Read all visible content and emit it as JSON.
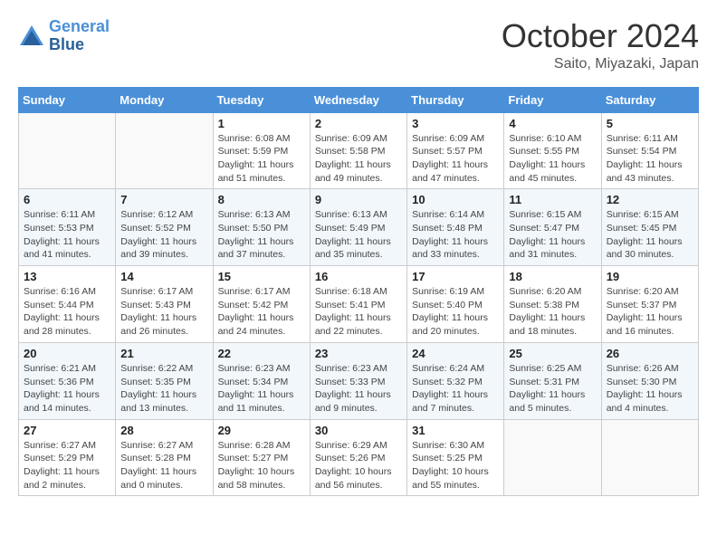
{
  "header": {
    "logo_line1": "General",
    "logo_line2": "Blue",
    "month": "October 2024",
    "location": "Saito, Miyazaki, Japan"
  },
  "weekdays": [
    "Sunday",
    "Monday",
    "Tuesday",
    "Wednesday",
    "Thursday",
    "Friday",
    "Saturday"
  ],
  "weeks": [
    [
      {
        "day": "",
        "info": ""
      },
      {
        "day": "",
        "info": ""
      },
      {
        "day": "1",
        "info": "Sunrise: 6:08 AM\nSunset: 5:59 PM\nDaylight: 11 hours and 51 minutes."
      },
      {
        "day": "2",
        "info": "Sunrise: 6:09 AM\nSunset: 5:58 PM\nDaylight: 11 hours and 49 minutes."
      },
      {
        "day": "3",
        "info": "Sunrise: 6:09 AM\nSunset: 5:57 PM\nDaylight: 11 hours and 47 minutes."
      },
      {
        "day": "4",
        "info": "Sunrise: 6:10 AM\nSunset: 5:55 PM\nDaylight: 11 hours and 45 minutes."
      },
      {
        "day": "5",
        "info": "Sunrise: 6:11 AM\nSunset: 5:54 PM\nDaylight: 11 hours and 43 minutes."
      }
    ],
    [
      {
        "day": "6",
        "info": "Sunrise: 6:11 AM\nSunset: 5:53 PM\nDaylight: 11 hours and 41 minutes."
      },
      {
        "day": "7",
        "info": "Sunrise: 6:12 AM\nSunset: 5:52 PM\nDaylight: 11 hours and 39 minutes."
      },
      {
        "day": "8",
        "info": "Sunrise: 6:13 AM\nSunset: 5:50 PM\nDaylight: 11 hours and 37 minutes."
      },
      {
        "day": "9",
        "info": "Sunrise: 6:13 AM\nSunset: 5:49 PM\nDaylight: 11 hours and 35 minutes."
      },
      {
        "day": "10",
        "info": "Sunrise: 6:14 AM\nSunset: 5:48 PM\nDaylight: 11 hours and 33 minutes."
      },
      {
        "day": "11",
        "info": "Sunrise: 6:15 AM\nSunset: 5:47 PM\nDaylight: 11 hours and 31 minutes."
      },
      {
        "day": "12",
        "info": "Sunrise: 6:15 AM\nSunset: 5:45 PM\nDaylight: 11 hours and 30 minutes."
      }
    ],
    [
      {
        "day": "13",
        "info": "Sunrise: 6:16 AM\nSunset: 5:44 PM\nDaylight: 11 hours and 28 minutes."
      },
      {
        "day": "14",
        "info": "Sunrise: 6:17 AM\nSunset: 5:43 PM\nDaylight: 11 hours and 26 minutes."
      },
      {
        "day": "15",
        "info": "Sunrise: 6:17 AM\nSunset: 5:42 PM\nDaylight: 11 hours and 24 minutes."
      },
      {
        "day": "16",
        "info": "Sunrise: 6:18 AM\nSunset: 5:41 PM\nDaylight: 11 hours and 22 minutes."
      },
      {
        "day": "17",
        "info": "Sunrise: 6:19 AM\nSunset: 5:40 PM\nDaylight: 11 hours and 20 minutes."
      },
      {
        "day": "18",
        "info": "Sunrise: 6:20 AM\nSunset: 5:38 PM\nDaylight: 11 hours and 18 minutes."
      },
      {
        "day": "19",
        "info": "Sunrise: 6:20 AM\nSunset: 5:37 PM\nDaylight: 11 hours and 16 minutes."
      }
    ],
    [
      {
        "day": "20",
        "info": "Sunrise: 6:21 AM\nSunset: 5:36 PM\nDaylight: 11 hours and 14 minutes."
      },
      {
        "day": "21",
        "info": "Sunrise: 6:22 AM\nSunset: 5:35 PM\nDaylight: 11 hours and 13 minutes."
      },
      {
        "day": "22",
        "info": "Sunrise: 6:23 AM\nSunset: 5:34 PM\nDaylight: 11 hours and 11 minutes."
      },
      {
        "day": "23",
        "info": "Sunrise: 6:23 AM\nSunset: 5:33 PM\nDaylight: 11 hours and 9 minutes."
      },
      {
        "day": "24",
        "info": "Sunrise: 6:24 AM\nSunset: 5:32 PM\nDaylight: 11 hours and 7 minutes."
      },
      {
        "day": "25",
        "info": "Sunrise: 6:25 AM\nSunset: 5:31 PM\nDaylight: 11 hours and 5 minutes."
      },
      {
        "day": "26",
        "info": "Sunrise: 6:26 AM\nSunset: 5:30 PM\nDaylight: 11 hours and 4 minutes."
      }
    ],
    [
      {
        "day": "27",
        "info": "Sunrise: 6:27 AM\nSunset: 5:29 PM\nDaylight: 11 hours and 2 minutes."
      },
      {
        "day": "28",
        "info": "Sunrise: 6:27 AM\nSunset: 5:28 PM\nDaylight: 11 hours and 0 minutes."
      },
      {
        "day": "29",
        "info": "Sunrise: 6:28 AM\nSunset: 5:27 PM\nDaylight: 10 hours and 58 minutes."
      },
      {
        "day": "30",
        "info": "Sunrise: 6:29 AM\nSunset: 5:26 PM\nDaylight: 10 hours and 56 minutes."
      },
      {
        "day": "31",
        "info": "Sunrise: 6:30 AM\nSunset: 5:25 PM\nDaylight: 10 hours and 55 minutes."
      },
      {
        "day": "",
        "info": ""
      },
      {
        "day": "",
        "info": ""
      }
    ]
  ]
}
